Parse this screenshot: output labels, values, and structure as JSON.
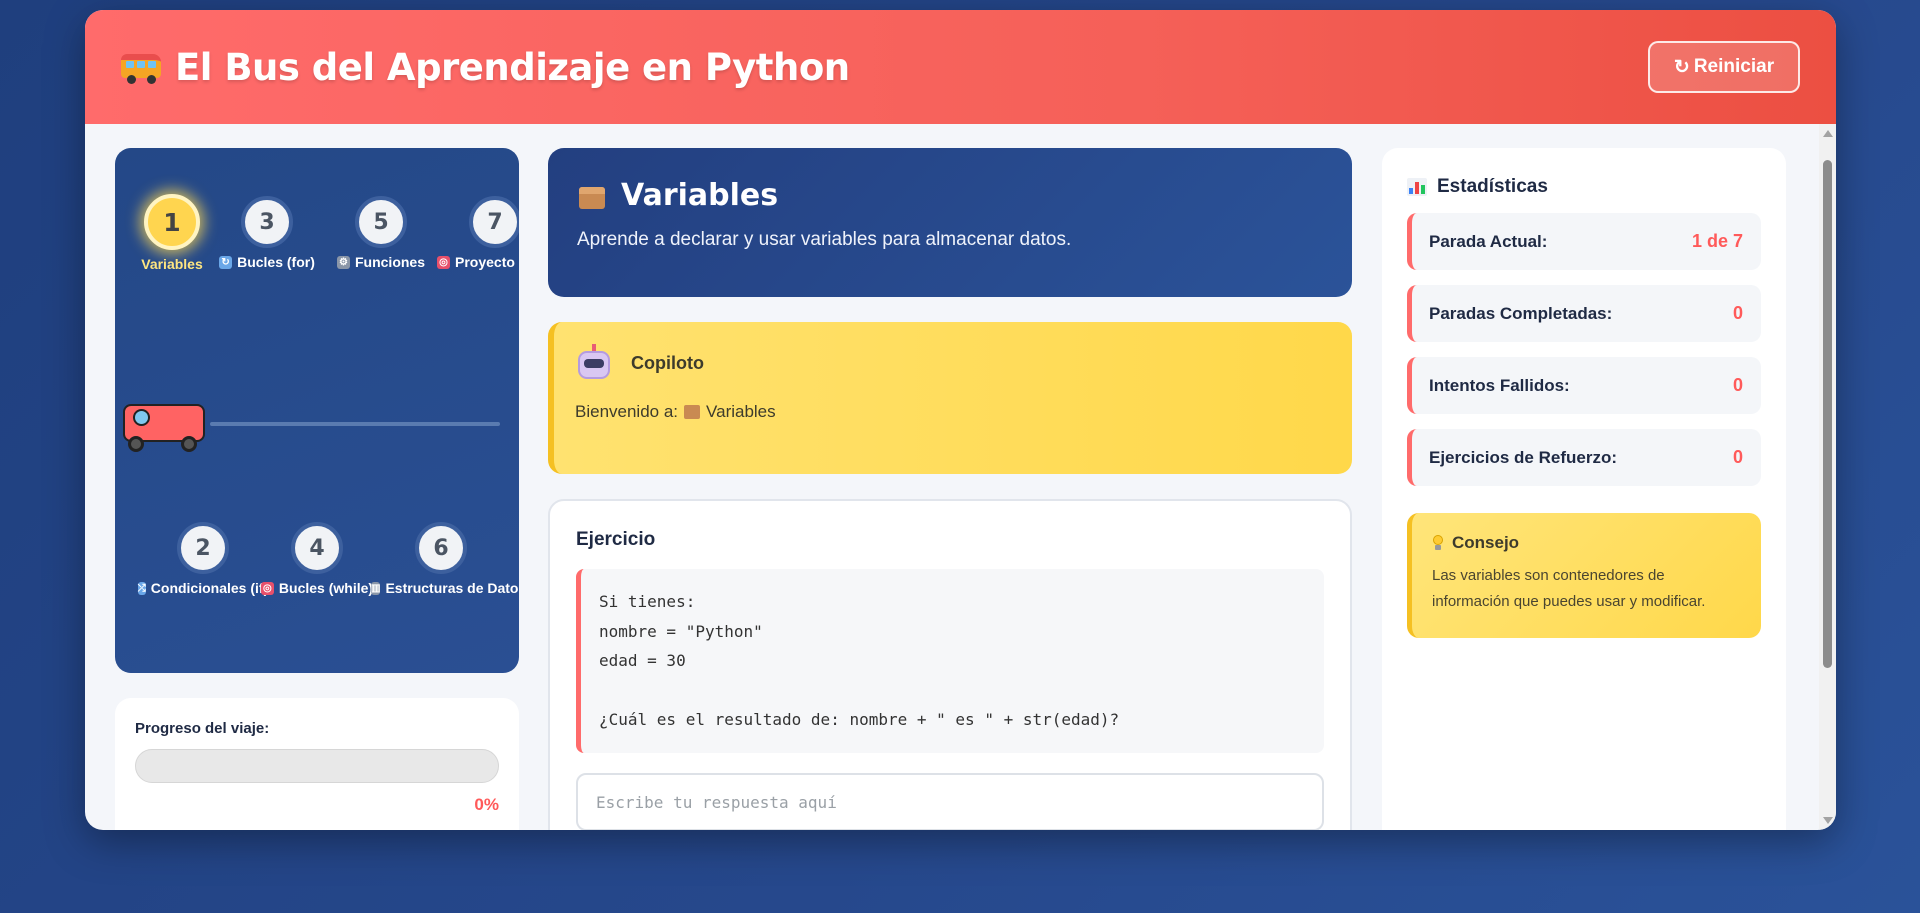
{
  "header": {
    "title": "El Bus del Aprendizaje en Python",
    "reset_icon": "↻",
    "reset_label": "Reiniciar"
  },
  "route": {
    "stops_top": [
      {
        "number": "1",
        "label": "Variables",
        "icon": "",
        "active": true
      },
      {
        "number": "3",
        "label": "Bucles (for)",
        "icon": "🔄",
        "active": false
      },
      {
        "number": "5",
        "label": "Funciones",
        "icon": "⚙",
        "active": false
      },
      {
        "number": "7",
        "label": "Proyecto",
        "icon": "🎯",
        "active": false
      }
    ],
    "stops_bottom": [
      {
        "number": "2",
        "label": "Condicionales (if)",
        "icon": "🔀",
        "active": false
      },
      {
        "number": "4",
        "label": "Bucles (while)",
        "icon": "🎯",
        "active": false
      },
      {
        "number": "6",
        "label": "Estructuras de Datos",
        "icon": "📊",
        "active": false
      }
    ]
  },
  "progress": {
    "title": "Progreso del viaje:",
    "percent_text": "0%",
    "fraction": 0
  },
  "topic": {
    "icon": "package-icon",
    "title": "Variables",
    "description": "Aprende a declarar y usar variables para almacenar datos."
  },
  "copilot": {
    "icon": "robot-icon",
    "name": "Copiloto",
    "message_prefix": "Bienvenido a:",
    "message_topic": "Variables"
  },
  "exercise": {
    "title": "Ejercicio",
    "code_lines": [
      "Si tienes:",
      "nombre = \"Python\"",
      "edad = 30",
      "",
      "¿Cuál es el resultado de: nombre + \" es \" + str(edad)?"
    ],
    "answer_placeholder": "Escribe tu respuesta aquí",
    "answer_value": ""
  },
  "stats": {
    "title": "Estadísticas",
    "rows": [
      {
        "label": "Parada Actual:",
        "value": "1 de 7"
      },
      {
        "label": "Paradas Completadas:",
        "value": "0"
      },
      {
        "label": "Intentos Fallidos:",
        "value": "0"
      },
      {
        "label": "Ejercicios de Refuerzo:",
        "value": "0"
      }
    ],
    "tip_title": "Consejo",
    "tip_text": "Las variables son contenedores de información que puedes usar y modificar."
  },
  "colors": {
    "header_accent": "#ff6b6b",
    "panel_blue": "#244887",
    "highlight_yellow": "#ffd54f",
    "value_red": "#ff5a5a"
  }
}
